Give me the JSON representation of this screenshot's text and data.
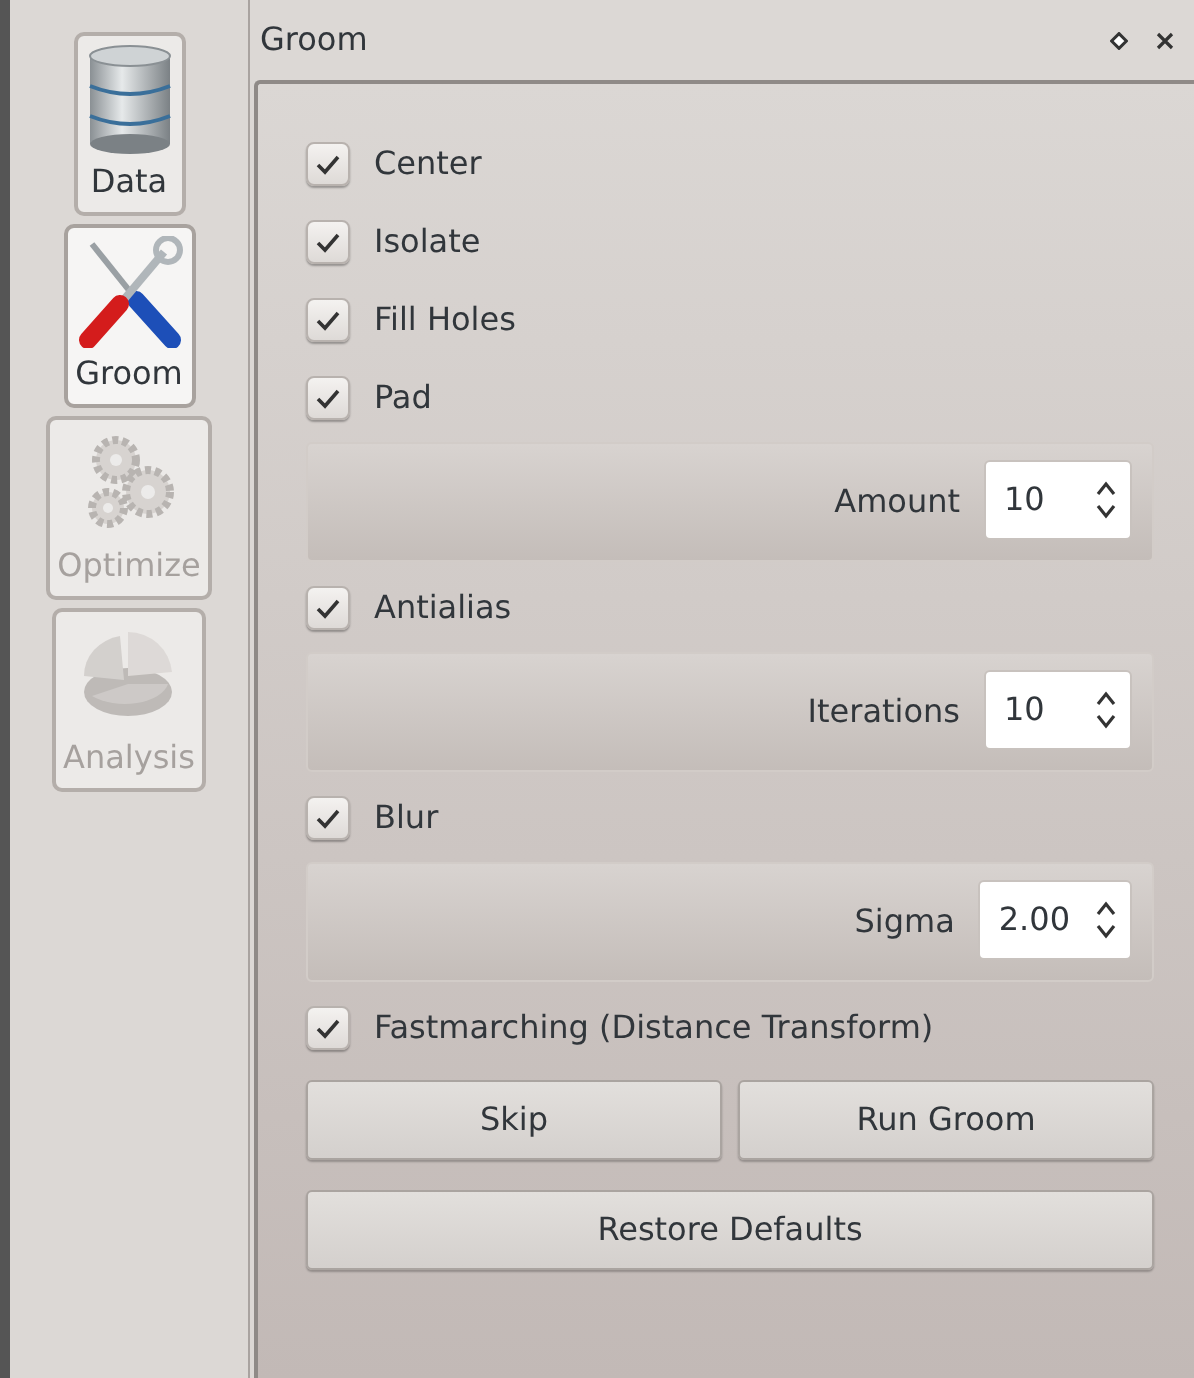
{
  "sidebar": {
    "items": [
      {
        "kind": "database",
        "label": "Data",
        "selected": false,
        "disabled": false
      },
      {
        "kind": "tools",
        "label": "Groom",
        "selected": true,
        "disabled": false
      },
      {
        "kind": "gears",
        "label": "Optimize",
        "selected": false,
        "disabled": true
      },
      {
        "kind": "pie",
        "label": "Analysis",
        "selected": false,
        "disabled": true
      }
    ]
  },
  "panel": {
    "title": "Groom",
    "options": [
      {
        "kind": "checkbox",
        "label": "Center",
        "checked": true
      },
      {
        "kind": "checkbox",
        "label": "Isolate",
        "checked": true
      },
      {
        "kind": "checkbox",
        "label": "Fill Holes",
        "checked": true
      },
      {
        "kind": "checkbox",
        "label": "Pad",
        "checked": true
      },
      {
        "kind": "spin",
        "label": "Amount",
        "value": "10"
      },
      {
        "kind": "checkbox",
        "label": "Antialias",
        "checked": true
      },
      {
        "kind": "spin",
        "label": "Iterations",
        "value": "10"
      },
      {
        "kind": "checkbox",
        "label": "Blur",
        "checked": true
      },
      {
        "kind": "spin",
        "label": "Sigma",
        "value": "2.00"
      },
      {
        "kind": "checkbox",
        "label": "Fastmarching (Distance Transform)",
        "checked": true
      }
    ],
    "buttons": [
      {
        "label": "Skip"
      },
      {
        "label": "Run Groom"
      }
    ],
    "restore": {
      "label": "Restore Defaults"
    }
  }
}
